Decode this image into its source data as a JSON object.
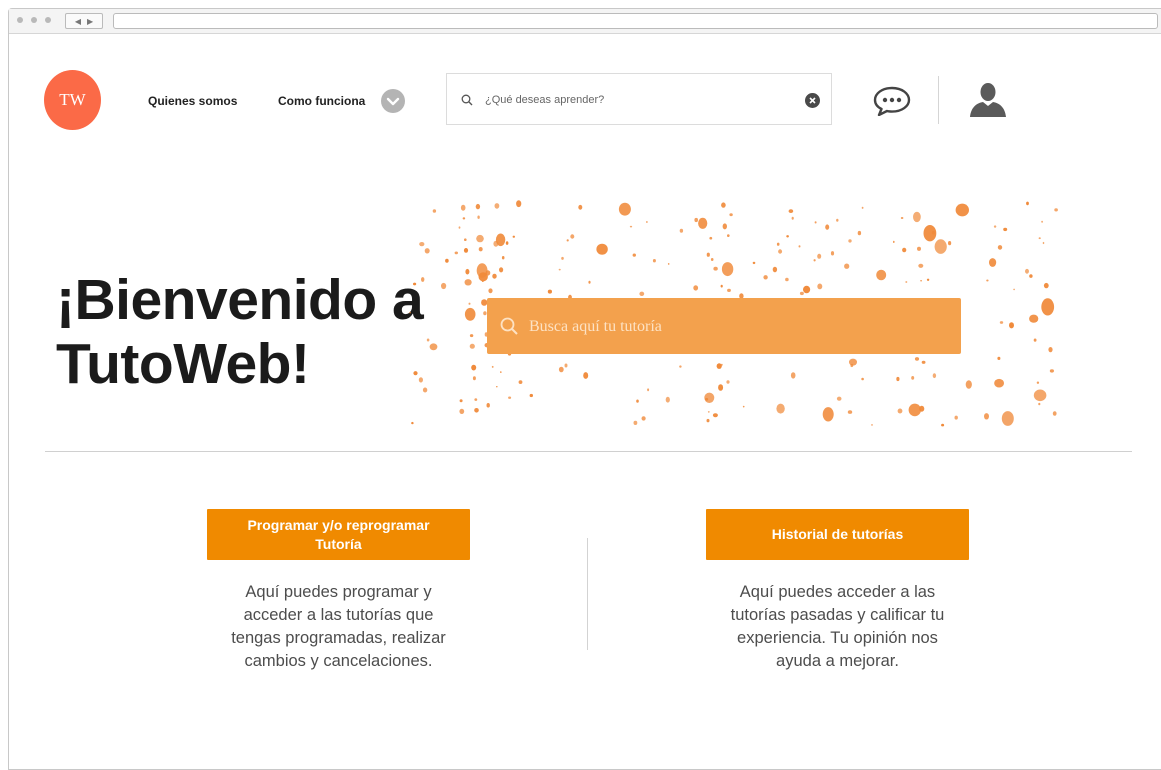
{
  "header": {
    "logo_text": "TW",
    "nav": [
      {
        "label": "Quienes somos"
      },
      {
        "label": "Como funciona"
      }
    ],
    "search_placeholder": "¿Qué deseas aprender?"
  },
  "hero": {
    "title_line1": "¡Bienvenido a",
    "title_line2": "TutoWeb!",
    "search_placeholder": "Busca aquí tu tutoría"
  },
  "cards": [
    {
      "button_line1": "Programar y/o reprogramar",
      "button_line2": "Tutoría",
      "description": [
        "Aquí puedes programar  y",
        "acceder a las tutorías que",
        "tengas programadas, realizar",
        "cambios y cancelaciones."
      ]
    },
    {
      "button_label": "Historial de tutorías",
      "description": [
        "Aquí puedes acceder a las",
        "tutorías pasadas y calificar tu",
        "experiencia. Tu opinión nos",
        "ayuda a mejorar."
      ]
    }
  ],
  "colors": {
    "logo": "#fb6a47",
    "accent": "#f08a00",
    "hero_search": "#f3a14d",
    "splatter": "#f08a3a"
  },
  "icons": [
    "search-icon",
    "clear-icon",
    "chevron-down-icon",
    "chat-icon",
    "user-icon"
  ]
}
